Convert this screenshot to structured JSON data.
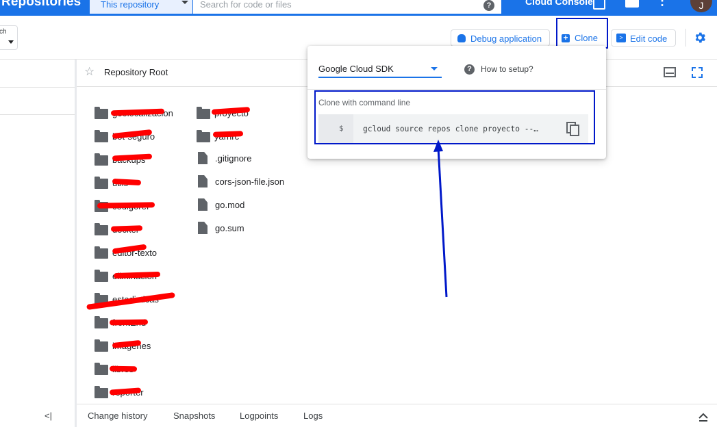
{
  "topbar": {
    "title": "Repositories",
    "scope_select": "This repository",
    "search_placeholder": "Search for code or files",
    "help_glyph": "?",
    "console_link": "Cloud Console",
    "avatar_letter": "J",
    "more_glyph": "⋮",
    "bar_color": "#1a73e8"
  },
  "toolbar": {
    "branch_label": "ch",
    "debug_label": "Debug application",
    "clone_label": "Clone",
    "edit_label": "Edit code",
    "clone_glyph": "+",
    "edit_glyph": ">",
    "accent_color": "#1a73e8"
  },
  "breadcrumb": {
    "star_glyph": "☆",
    "root_label": "Repository Root"
  },
  "left_panel": {
    "collapse_glyph": "<|"
  },
  "folders": [
    {
      "label": "geolocalizacion"
    },
    {
      "label": "bot-seguro"
    },
    {
      "label": "backups"
    },
    {
      "label": "utils"
    },
    {
      "label": "codigoref"
    },
    {
      "label": "docker"
    },
    {
      "label": "editor-texto"
    },
    {
      "label": "eliminacion"
    },
    {
      "label": "estadisticas"
    },
    {
      "label": "frontEnd"
    },
    {
      "label": "imagenes"
    },
    {
      "label": "libros"
    },
    {
      "label": "reporter"
    }
  ],
  "folders_col2": [
    {
      "label": "proyecto"
    },
    {
      "label": "yarnrc"
    }
  ],
  "files": [
    {
      "label": ".gitignore"
    },
    {
      "label": "cors-json-file.json"
    },
    {
      "label": "go.mod"
    },
    {
      "label": "go.sum"
    }
  ],
  "clone_popup": {
    "sdk_select": "Google Cloud SDK",
    "help_glyph": "?",
    "how_to_setup": "How to setup?",
    "section_label": "Clone with command line",
    "prompt": "$",
    "command": "gcloud source repos clone proyecto --…"
  },
  "bottom_tabs": [
    {
      "label": "Change history"
    },
    {
      "label": "Snapshots"
    },
    {
      "label": "Logpoints"
    },
    {
      "label": "Logs"
    }
  ],
  "annotation_color": "#0018c9",
  "redaction_color": "#ff0000"
}
